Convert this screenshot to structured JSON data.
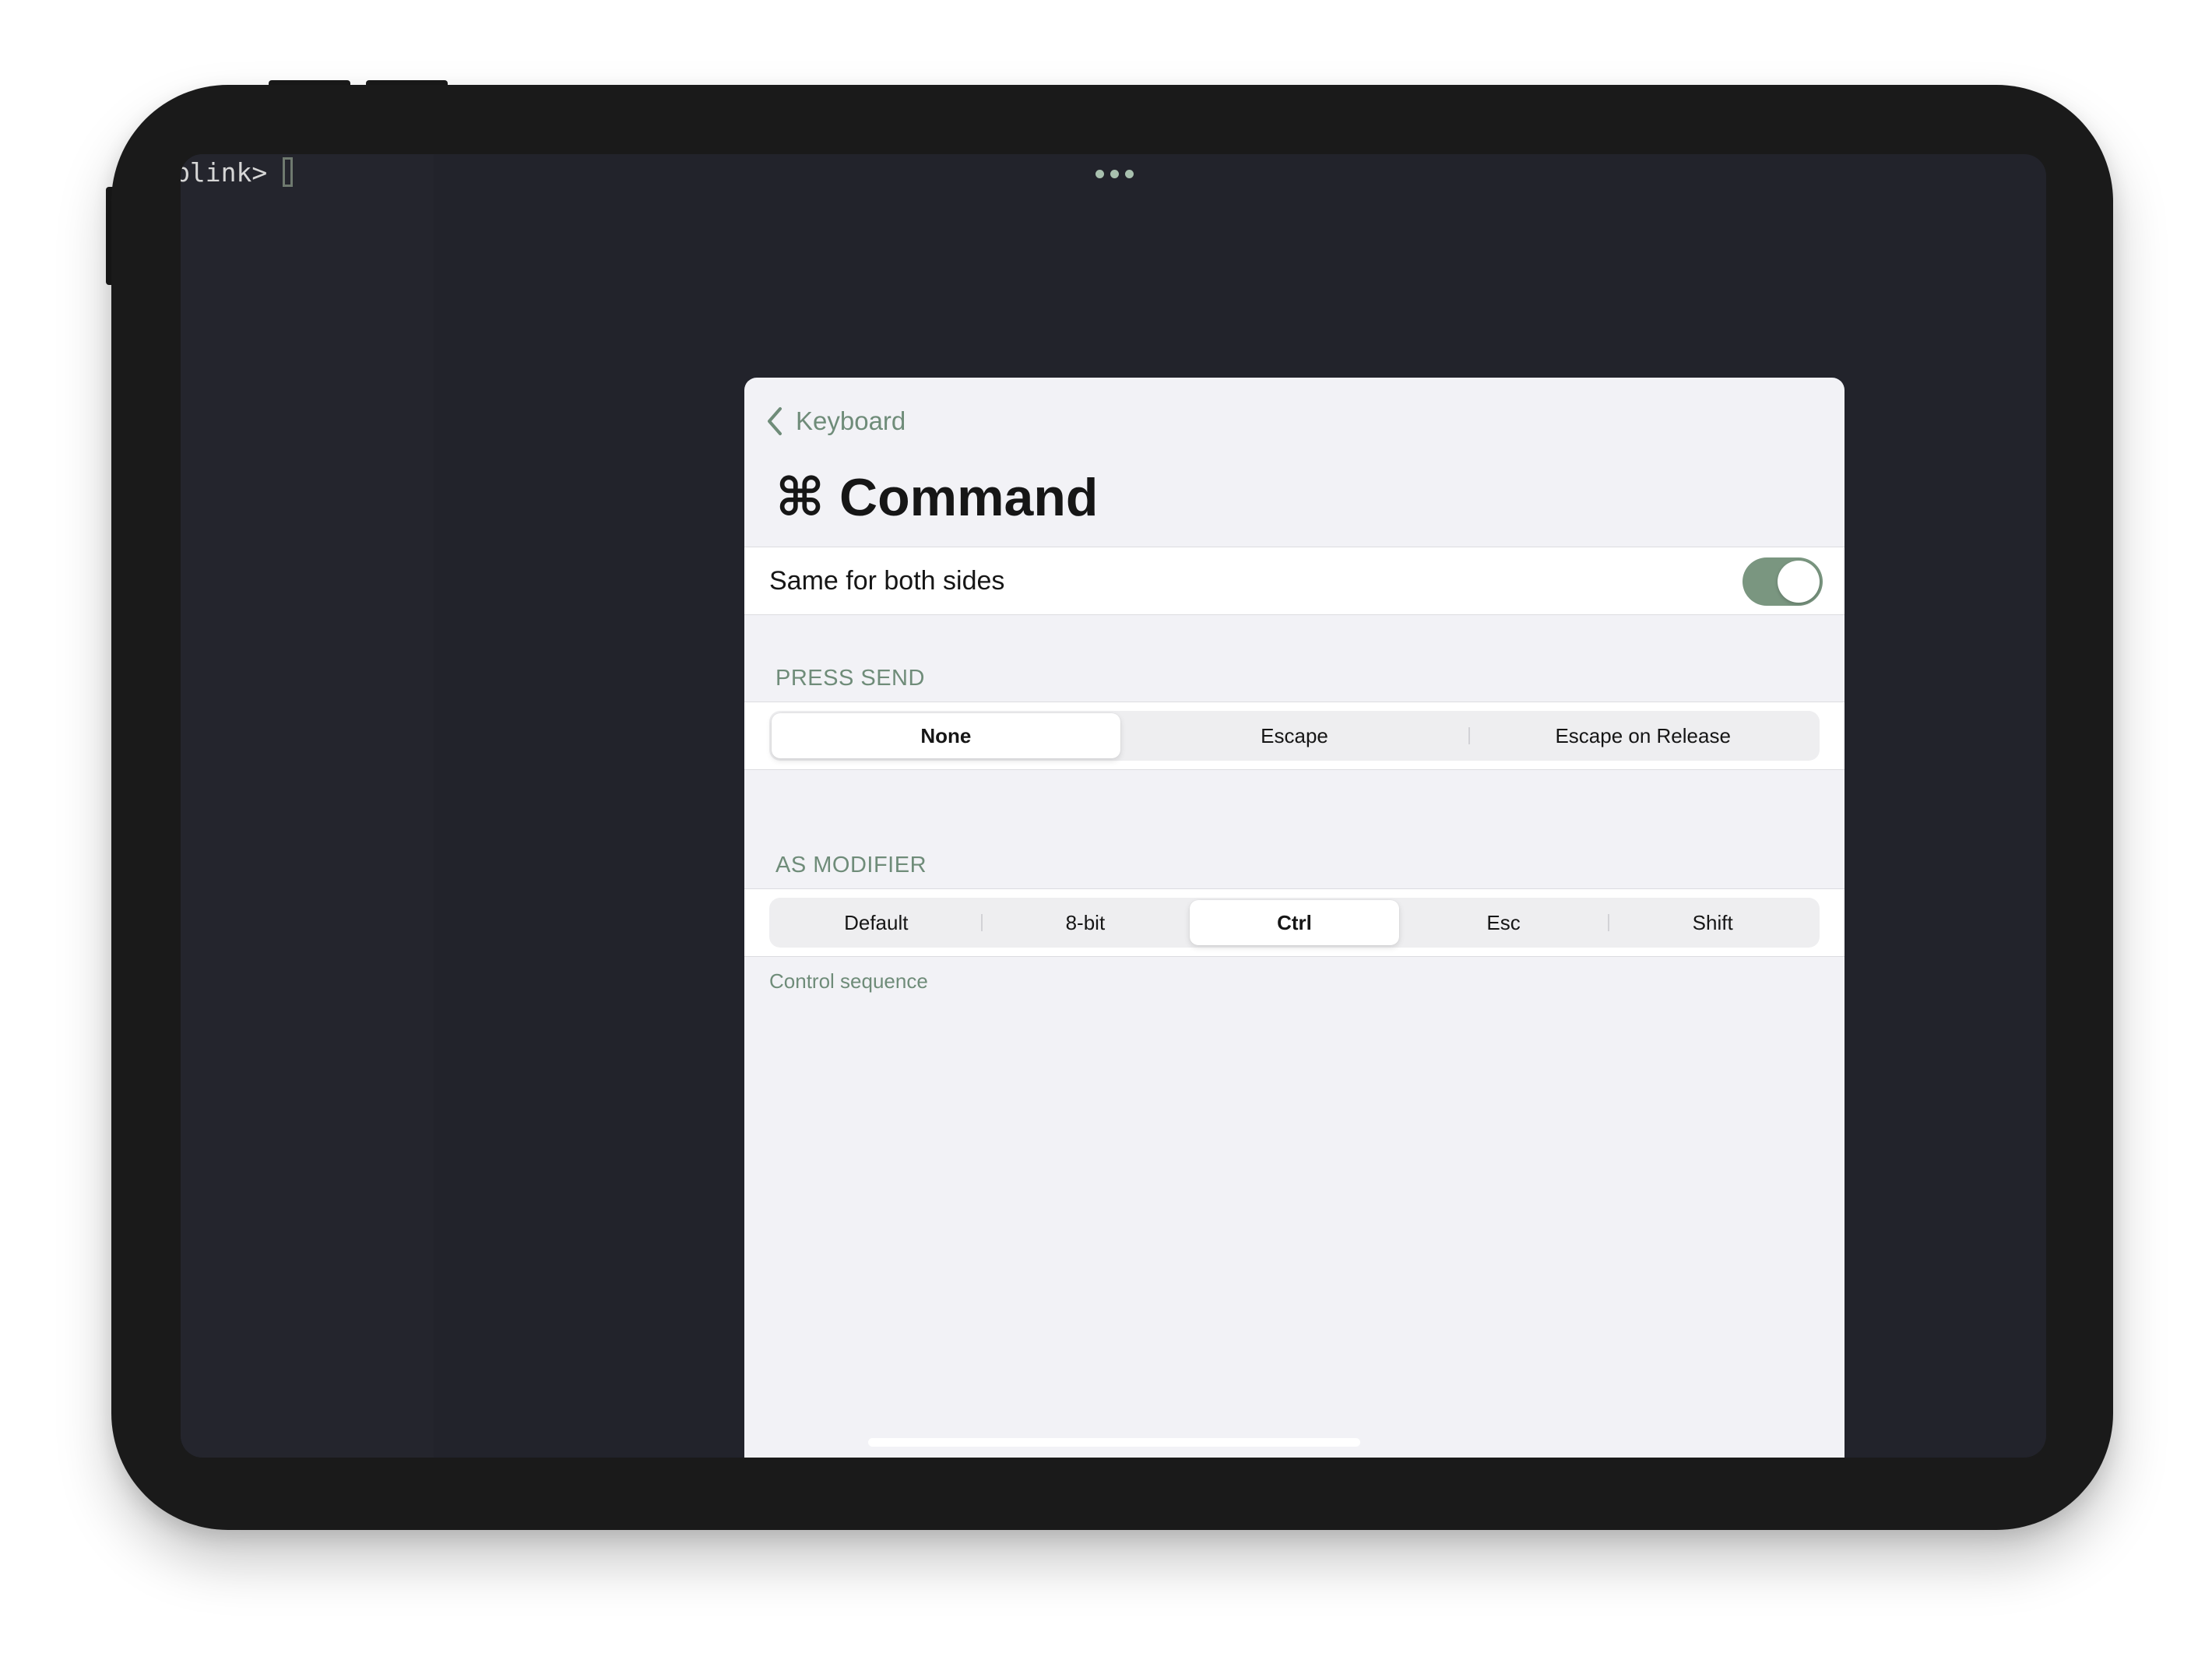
{
  "terminal": {
    "prompt": "blink>"
  },
  "nav": {
    "back_label": "Keyboard"
  },
  "page": {
    "title": "⌘ Command"
  },
  "toggle_row": {
    "label": "Same for both sides",
    "value": true
  },
  "press_send": {
    "header": "PRESS SEND",
    "options": [
      "None",
      "Escape",
      "Escape on Release"
    ],
    "selected": "None"
  },
  "as_modifier": {
    "header": "AS MODIFIER",
    "options": [
      "Default",
      "8-bit",
      "Ctrl",
      "Esc",
      "Shift"
    ],
    "selected": "Ctrl",
    "footer": "Control sequence"
  },
  "colors": {
    "accent": "#6f8c79",
    "toggle_on": "#7a9680",
    "terminal_bg": "#22232b",
    "sheet_bg": "#f2f2f6"
  },
  "icons": {
    "back": "chevron-left-icon",
    "more": "ellipsis-icon"
  }
}
